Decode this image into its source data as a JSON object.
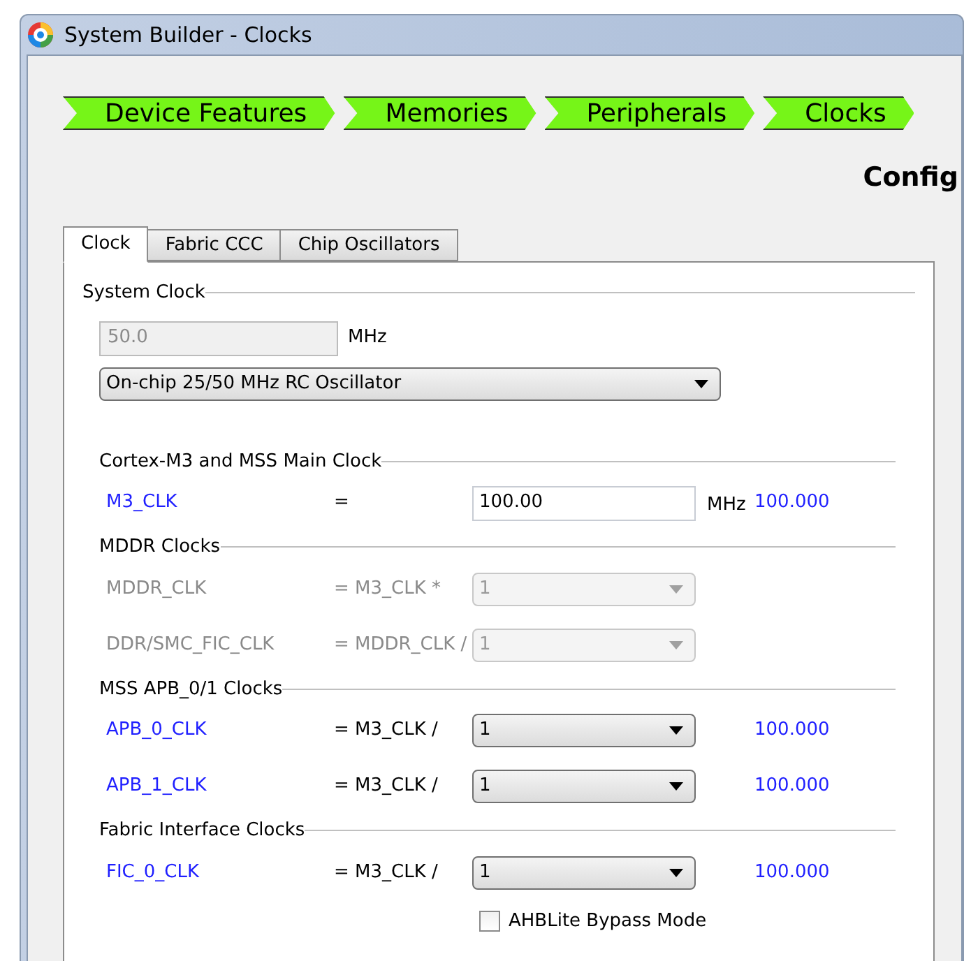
{
  "window": {
    "title": "System Builder - Clocks"
  },
  "steps": [
    "Device Features",
    "Memories",
    "Peripherals",
    "Clocks"
  ],
  "heading": "Config",
  "tabs": [
    {
      "label": "Clock",
      "selected": true
    },
    {
      "label": "Fabric CCC",
      "selected": false
    },
    {
      "label": "Chip Oscillators",
      "selected": false
    }
  ],
  "system_clock": {
    "title": "System Clock",
    "frequency": "50.0",
    "frequency_disabled": true,
    "unit": "MHz",
    "source": "On-chip 25/50 MHz RC Oscillator"
  },
  "sections": [
    {
      "title": "Cortex-M3 and MSS Main Clock",
      "rows": [
        {
          "kind": "input",
          "name": "M3_CLK",
          "operator": "=",
          "value": "100.00",
          "unit": "MHz",
          "result": "100.000",
          "disabled": false
        }
      ]
    },
    {
      "title": "MDDR Clocks",
      "rows": [
        {
          "kind": "select",
          "name": "MDDR_CLK",
          "operator": "= M3_CLK *",
          "value": "1",
          "disabled": true
        },
        {
          "kind": "select",
          "name": "DDR/SMC_FIC_CLK",
          "operator": "= MDDR_CLK /",
          "value": "1",
          "disabled": true
        }
      ]
    },
    {
      "title": "MSS APB_0/1 Clocks",
      "rows": [
        {
          "kind": "select",
          "name": "APB_0_CLK",
          "operator": "= M3_CLK /",
          "value": "1",
          "result": "100.000",
          "disabled": false
        },
        {
          "kind": "select",
          "name": "APB_1_CLK",
          "operator": "= M3_CLK /",
          "value": "1",
          "result": "100.000",
          "disabled": false
        }
      ]
    },
    {
      "title": "Fabric Interface Clocks",
      "rows": [
        {
          "kind": "select",
          "name": "FIC_0_CLK",
          "operator": "= M3_CLK /",
          "value": "1",
          "result": "100.000",
          "disabled": false
        },
        {
          "kind": "checkbox",
          "label": "AHBLite Bypass Mode",
          "checked": false
        }
      ]
    }
  ]
}
